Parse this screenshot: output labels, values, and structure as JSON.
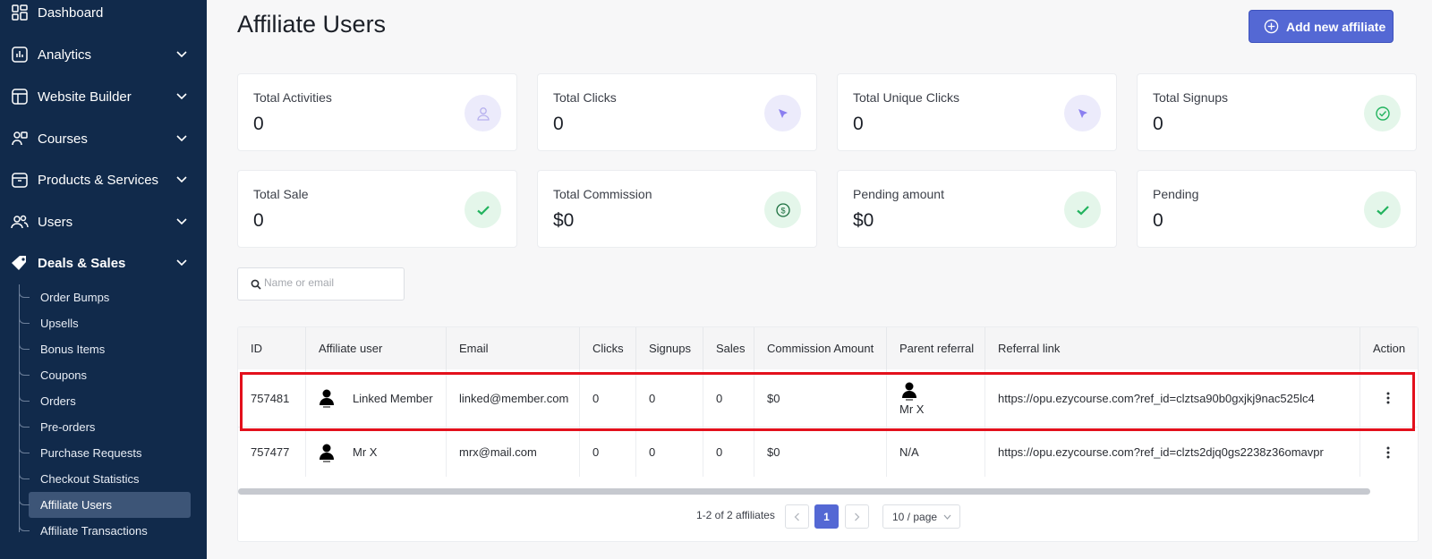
{
  "sidebar": {
    "items": [
      {
        "label": "Dashboard",
        "icon": "dashboard-icon"
      },
      {
        "label": "Analytics",
        "icon": "analytics-icon"
      },
      {
        "label": "Website Builder",
        "icon": "website-builder-icon"
      },
      {
        "label": "Courses",
        "icon": "courses-icon"
      },
      {
        "label": "Products & Services",
        "icon": "products-icon"
      },
      {
        "label": "Users",
        "icon": "users-icon"
      },
      {
        "label": "Deals & Sales",
        "icon": "deals-tag-icon"
      }
    ],
    "sub_items": [
      {
        "label": "Order Bumps"
      },
      {
        "label": "Upsells"
      },
      {
        "label": "Bonus Items"
      },
      {
        "label": "Coupons"
      },
      {
        "label": "Orders"
      },
      {
        "label": "Pre-orders"
      },
      {
        "label": "Purchase Requests"
      },
      {
        "label": "Checkout Statistics"
      },
      {
        "label": "Affiliate Users"
      },
      {
        "label": "Affiliate Transactions"
      }
    ],
    "active_sub_item": "Affiliate Users"
  },
  "header": {
    "title": "Affiliate Users",
    "add_button_label": "Add new affiliate"
  },
  "stats": [
    {
      "label": "Total Activities",
      "value": "0",
      "icon": "user-icon"
    },
    {
      "label": "Total Clicks",
      "value": "0",
      "icon": "cursor-icon"
    },
    {
      "label": "Total Unique Clicks",
      "value": "0",
      "icon": "cursor-icon"
    },
    {
      "label": "Total Signups",
      "value": "0",
      "icon": "check-circle-icon"
    },
    {
      "label": "Total Sale",
      "value": "0",
      "icon": "check-icon"
    },
    {
      "label": "Total Commission",
      "value": "$0",
      "icon": "dollar-circle-icon"
    },
    {
      "label": "Pending amount",
      "value": "$0",
      "icon": "check-icon"
    },
    {
      "label": "Pending",
      "value": "0",
      "icon": "check-icon"
    }
  ],
  "search": {
    "placeholder": "Name or email",
    "value": ""
  },
  "table": {
    "columns": [
      "ID",
      "Affiliate user",
      "Email",
      "Clicks",
      "Signups",
      "Sales",
      "Commission Amount",
      "Parent referral",
      "Referral link",
      "Action"
    ],
    "rows": [
      {
        "id": "757481",
        "user": "Linked Member",
        "email": "linked@member.com",
        "clicks": "0",
        "signups": "0",
        "sales": "0",
        "commission": "$0",
        "parent": "Mr X",
        "link": "https://opu.ezycourse.com?ref_id=clztsa90b0gxjkj9nac525lc4"
      },
      {
        "id": "757477",
        "user": "Mr X",
        "email": "mrx@mail.com",
        "clicks": "0",
        "signups": "0",
        "sales": "0",
        "commission": "$0",
        "parent": "N/A",
        "link": "https://opu.ezycourse.com?ref_id=clzts2djq0gs2238z36omavpr"
      }
    ]
  },
  "pagination": {
    "summary": "1-2 of 2 affiliates",
    "current_page": "1",
    "per_page": "10 / page"
  },
  "colors": {
    "sidebar_bg": "#112a4b",
    "accent": "#5468d4",
    "highlight": "#e3101c",
    "success": "#22b35e"
  }
}
